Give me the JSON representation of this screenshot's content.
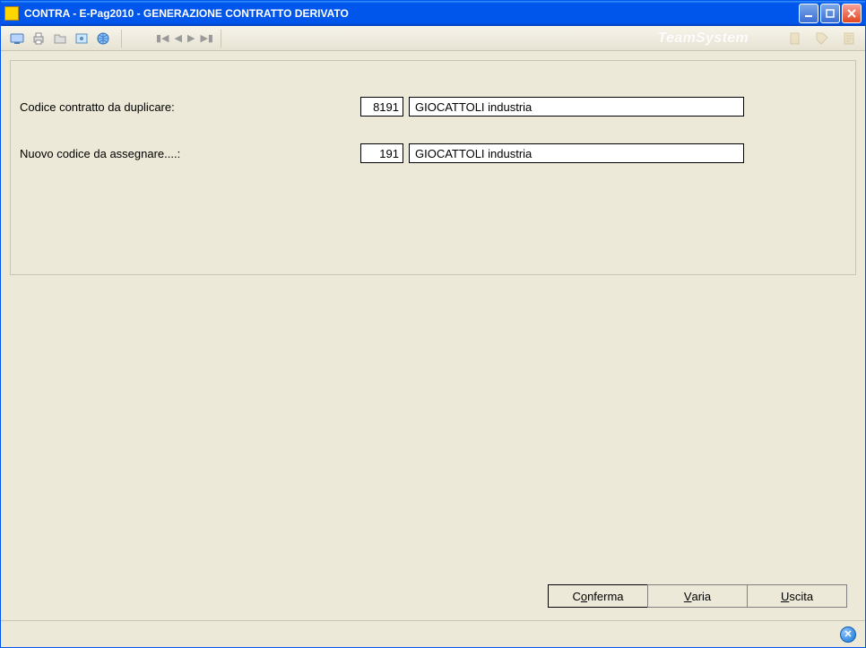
{
  "title": "CONTRA  - E-Pag2010  -  GENERAZIONE CONTRATTO DERIVATO",
  "brand": "TeamSystem",
  "form": {
    "row1": {
      "label": "Codice contratto da duplicare:",
      "code": "8191",
      "desc": "GIOCATTOLI industria"
    },
    "row2": {
      "label": "Nuovo codice da assegnare....:",
      "code": "191",
      "desc": "GIOCATTOLI industria"
    }
  },
  "buttons": {
    "confirm_pre": "C",
    "confirm_u": "o",
    "confirm_post": "nferma",
    "varia_pre": "",
    "varia_u": "V",
    "varia_post": "aria",
    "uscita_pre": "",
    "uscita_u": "U",
    "uscita_post": "scita"
  }
}
